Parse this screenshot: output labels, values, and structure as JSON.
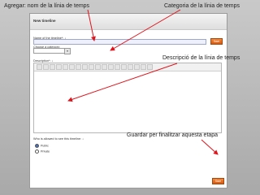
{
  "annotations": {
    "agregar": "Agregar: nom de la línia de temps",
    "categoria": "Categoria de la línia de temps",
    "descripcio": "Descripció de la línia de temps",
    "guardar": "Guardar per finalitzar aquesta etapa"
  },
  "form": {
    "title": "New timeline",
    "name_label": "Name of the timeline*: ↓",
    "category_label": "Choose a category:",
    "description_label": "Description*: ↓",
    "who_label": "Who is allowed to see this timeline: ↓",
    "save_label": "Save",
    "visibility": [
      {
        "label": "Public",
        "selected": true
      },
      {
        "label": "Private",
        "selected": false
      }
    ]
  },
  "colors": {
    "arrow": "#e0141c",
    "save_button": "#e8732a"
  }
}
